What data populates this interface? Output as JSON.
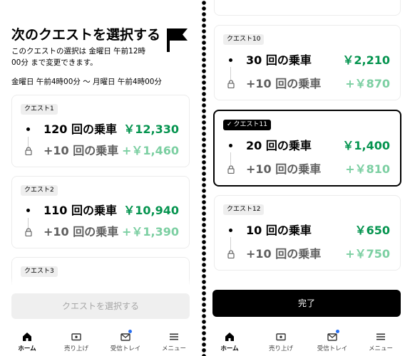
{
  "header": {
    "title": "次のクエストを選択する",
    "subtitle": "このクエストの選択は 金曜日 午前12時00分 まで変更できます。",
    "date_range": "金曜日 午前4時00分 ～ 月曜日 午前4時00分"
  },
  "left_quests": [
    {
      "badge": "クエスト1",
      "rides": "120 回の乗車",
      "amount": "￥12,330",
      "bonus_rides": "+10 回の乗車",
      "bonus_amount": "+￥1,460"
    },
    {
      "badge": "クエスト2",
      "rides": "110 回の乗車",
      "amount": "￥10,940",
      "bonus_rides": "+10 回の乗車",
      "bonus_amount": "+￥1,390"
    },
    {
      "badge": "クエスト3"
    }
  ],
  "right_quests": [
    {
      "badge": "クエスト10",
      "rides": "30 回の乗車",
      "amount": "￥2,210",
      "bonus_rides": "+10 回の乗車",
      "bonus_amount": "+￥870"
    },
    {
      "badge": "クエスト11",
      "rides": "20 回の乗車",
      "amount": "￥1,400",
      "bonus_rides": "+10 回の乗車",
      "bonus_amount": "+￥810",
      "selected": true
    },
    {
      "badge": "クエスト12",
      "rides": "10 回の乗車",
      "amount": "￥650",
      "bonus_rides": "+10 回の乗車",
      "bonus_amount": "+￥750"
    }
  ],
  "buttons": {
    "select_quest": "クエストを選択する",
    "done": "完了"
  },
  "nav": [
    {
      "label": "ホーム",
      "icon": "home-icon",
      "active": true
    },
    {
      "label": "売り上げ",
      "icon": "earnings-icon"
    },
    {
      "label": "受信トレイ",
      "icon": "inbox-icon",
      "notification": true
    },
    {
      "label": "メニュー",
      "icon": "menu-icon"
    }
  ],
  "colors": {
    "amount": "#05944f",
    "bonus_amount": "#7ccfa2",
    "notification": "#276ef1"
  }
}
